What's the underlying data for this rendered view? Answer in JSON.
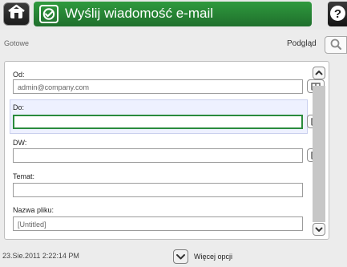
{
  "title": "Wyślij wiadomość e-mail",
  "status": "Gotowe",
  "preview": "Podgląd",
  "fields": {
    "from": {
      "label": "Od:",
      "value": "admin@company.com"
    },
    "to": {
      "label": "Do:",
      "value": ""
    },
    "cc": {
      "label": "DW:",
      "value": ""
    },
    "subject": {
      "label": "Temat:",
      "value": ""
    },
    "filename": {
      "label": "Nazwa pliku:",
      "value": "[Untitled]"
    }
  },
  "footer": {
    "timestamp": "23.Sie.2011 2:22:14 PM",
    "more_options": "Więcej opcji"
  },
  "icons": {
    "home": "home-icon",
    "title": "email-icon",
    "help": "help-icon",
    "preview": "search-icon",
    "address_book": "address-book-icon",
    "scroll_up": "chevron-up-icon",
    "scroll_down": "chevron-down-icon",
    "more_options": "chevron-down-icon"
  },
  "colors": {
    "accent": "#2a8b3d",
    "title_bar": "#1f6f2c"
  }
}
